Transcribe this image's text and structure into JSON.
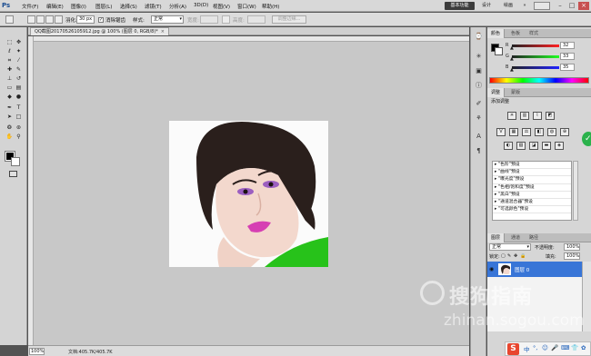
{
  "app": {
    "logo": "Ps",
    "menus": [
      "文件(F)",
      "编辑(E)",
      "图像(I)",
      "图层(L)",
      "选择(S)",
      "滤镜(T)",
      "分析(A)",
      "3D(D)",
      "视图(V)",
      "窗口(W)",
      "帮助(H)"
    ],
    "workspaces": {
      "essentials": "基本功能",
      "design": "设计",
      "painting": "绘画",
      "more": "»"
    },
    "window_buttons": {
      "minimize": "–",
      "maximize": "□",
      "close": "×"
    }
  },
  "options_bar": {
    "feather_label": "羽化:",
    "feather_value": "30 px",
    "antialias_label": "消除锯齿",
    "antialias_checked": "✓",
    "style_label": "样式:",
    "style_value": "正常",
    "width_label": "宽度:",
    "height_label": "高度:",
    "refine_edge": "调整边缘..."
  },
  "document": {
    "tab_title": "QQ截图20170526105912.jpg @ 100% (图层 0, RGB/8)",
    "tab_modified": "*",
    "tab_close": "×",
    "zoom": "100%",
    "doc_size": "文档:405.7K/405.7K"
  },
  "color_panel": {
    "tabs": [
      "颜色",
      "色板",
      "样式"
    ],
    "channels": [
      {
        "label": "R",
        "value": "32",
        "color": "#d01818"
      },
      {
        "label": "G",
        "value": "33",
        "color": "#18a418"
      },
      {
        "label": "B",
        "value": "35",
        "color": "#1a3ed0"
      }
    ]
  },
  "adjustments_panel": {
    "tabs": [
      "调整",
      "蒙版"
    ],
    "title": "添加调整",
    "presets": [
      "\"色阶\"预设",
      "\"曲线\"预设",
      "\"曝光度\"预设",
      "\"色相/饱和度\"预设",
      "\"黑白\"预设",
      "\"通道混合器\"预设",
      "\"可选颜色\"预设"
    ]
  },
  "layers_panel": {
    "tabs": [
      "图层",
      "通道",
      "路径"
    ],
    "blend_mode": "正常",
    "opacity_label": "不透明度:",
    "opacity_value": "100%",
    "lock_label": "锁定:",
    "fill_label": "填充:",
    "fill_value": "100%",
    "layers": [
      {
        "name": "图层 0",
        "selected": true
      }
    ]
  },
  "watermark": {
    "brand": "搜狗指南",
    "url": "zhinan.sogou.com"
  },
  "ime": {
    "logo": "S",
    "items": [
      "中",
      "°,",
      "☺",
      "🎤",
      "⌨",
      "👕",
      "✿"
    ]
  },
  "colors": {
    "accent": "#3875d7",
    "canvas_bg": "#c8c8c8",
    "workspace_active": "#3c3c3c"
  }
}
